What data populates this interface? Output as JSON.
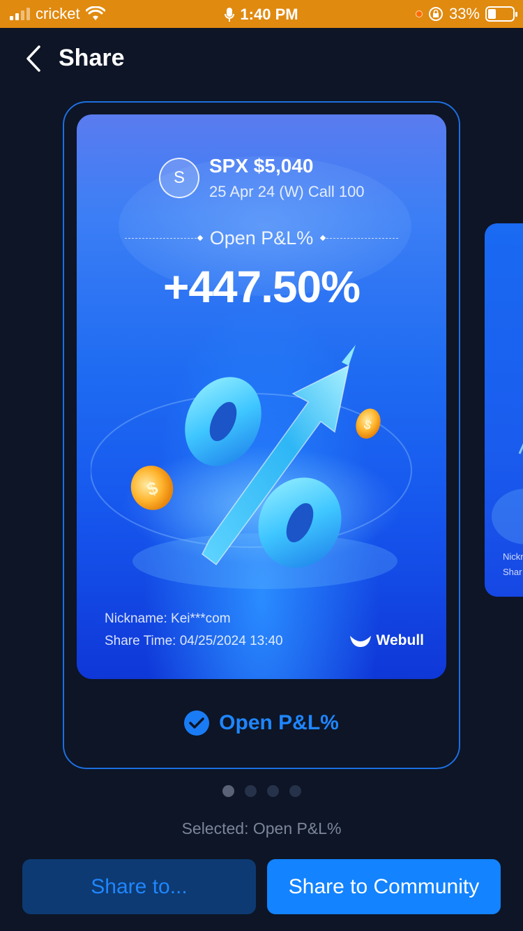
{
  "status_bar": {
    "carrier": "cricket",
    "time": "1:40 PM",
    "battery_percent": "33%",
    "battery_level": 0.33,
    "icons": [
      "signal-icon",
      "wifi-icon",
      "mic-icon",
      "orientation-lock-icon",
      "battery-icon"
    ]
  },
  "nav": {
    "title": "Share"
  },
  "card": {
    "avatar_letter": "S",
    "ticker": "SPX $5,040",
    "contract": "25 Apr 24 (W) Call 100",
    "metric_label": "Open P&L%",
    "metric_value": "+447.50%",
    "nickname": "Nickname: Kei***com",
    "share_time": "Share Time: 04/25/2024 13:40",
    "brand": "Webull"
  },
  "peek_card": {
    "nickname_fragment": "Nickn",
    "share_fragment": "Shar"
  },
  "option": {
    "label": "Open P&L%",
    "checked": true
  },
  "pager": {
    "total": 4,
    "active_index": 0
  },
  "selected_text": "Selected: Open P&L%",
  "buttons": {
    "share_to": "Share to...",
    "share_community": "Share to Community"
  },
  "colors": {
    "status_bar": "#e08a10",
    "background": "#0d1526",
    "accent": "#1383ff",
    "frame_border": "#1d6fe0"
  }
}
